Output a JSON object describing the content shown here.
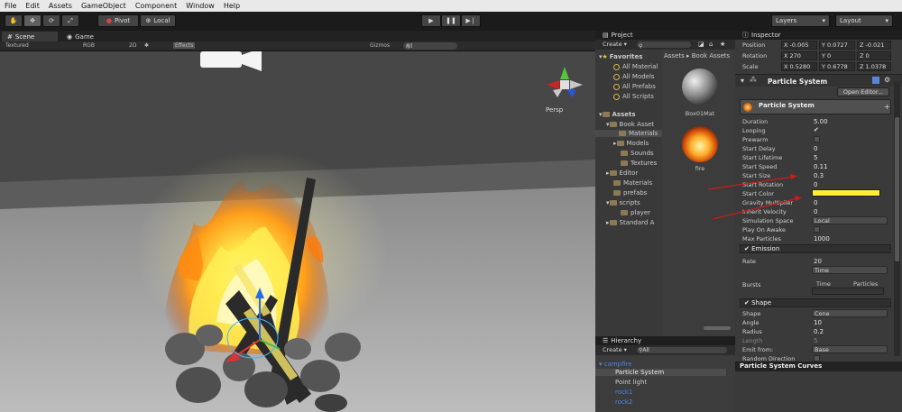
{
  "menu": [
    "File",
    "Edit",
    "Assets",
    "GameObject",
    "Component",
    "Window",
    "Help"
  ],
  "toolbar": {
    "pivot_label": "Pivot",
    "local_label": "Local",
    "layers_label": "Layers",
    "layout_label": "Layout"
  },
  "scene": {
    "tab_scene": "Scene",
    "tab_game": "Game",
    "render_mode": "Textured",
    "color_mode": "RGB",
    "mode_2d": "2D",
    "effects_label": "Effects",
    "gizmos_label": "Gizmos",
    "search_placeholder": "All",
    "persp_label": "Persp"
  },
  "project": {
    "title": "Project",
    "create_label": "Create",
    "breadcrumb": "Assets ▸ Book Assets",
    "favorites_label": "Favorites",
    "favorites": [
      "All Material",
      "All Models",
      "All Prefabs",
      "All Scripts"
    ],
    "assets_label": "Assets",
    "tree": [
      {
        "label": "Book Asset",
        "indent": 1
      },
      {
        "label": "Materials",
        "indent": 2,
        "selected": true
      },
      {
        "label": "Models",
        "indent": 2
      },
      {
        "label": "Sounds",
        "indent": 2
      },
      {
        "label": "Textures",
        "indent": 2
      },
      {
        "label": "Editor",
        "indent": 1
      },
      {
        "label": "Materials",
        "indent": 1
      },
      {
        "label": "prefabs",
        "indent": 1
      },
      {
        "label": "scripts",
        "indent": 1
      },
      {
        "label": "player",
        "indent": 2
      },
      {
        "label": "Standard A",
        "indent": 1
      }
    ],
    "items": [
      {
        "label": "Box01Mat",
        "kind": "sphere"
      },
      {
        "label": "fire",
        "kind": "fire"
      }
    ]
  },
  "hierarchy": {
    "title": "Hierarchy",
    "create_label": "Create",
    "search_placeholder": "All",
    "items": [
      {
        "label": "campfire",
        "color": "#4d86e6",
        "indent": 0
      },
      {
        "label": "Particle System",
        "color": "#e4e4e4",
        "indent": 1,
        "selected": true
      },
      {
        "label": "Point light",
        "color": "#d8d8d8",
        "indent": 1
      },
      {
        "label": "rock1",
        "color": "#4d86e6",
        "indent": 1
      },
      {
        "label": "rock2",
        "color": "#4d86e6",
        "indent": 1
      }
    ]
  },
  "inspector": {
    "title": "Inspector",
    "transform": {
      "position_label": "Position",
      "rotation_label": "Rotation",
      "scale_label": "Scale",
      "position": [
        "X -0.005",
        "Y 0.0727",
        "Z -0.021"
      ],
      "rotation": [
        "X 270",
        "Y 0",
        "Z 0"
      ],
      "scale": [
        "X 0.5280",
        "Y 0.6778",
        "Z 1.0378"
      ]
    },
    "component_title": "Particle System",
    "open_editor_label": "Open Editor...",
    "module_title": "Particle System",
    "props": [
      {
        "label": "Duration",
        "value": "5.00"
      },
      {
        "label": "Looping",
        "value": "✔"
      },
      {
        "label": "Prewarm",
        "value": ""
      },
      {
        "label": "Start Delay",
        "value": "0"
      },
      {
        "label": "Start Lifetime",
        "value": "5"
      },
      {
        "label": "Start Speed",
        "value": "0.11"
      },
      {
        "label": "Start Size",
        "value": "0.3"
      },
      {
        "label": "Start Rotation",
        "value": "0"
      },
      {
        "label": "Start Color",
        "value": ""
      },
      {
        "label": "Gravity Multiplier",
        "value": "0"
      },
      {
        "label": "Inherit Velocity",
        "value": "0"
      },
      {
        "label": "Simulation Space",
        "value": "Local"
      },
      {
        "label": "Play On Awake",
        "value": ""
      },
      {
        "label": "Max Particles",
        "value": "1000"
      }
    ],
    "emission": {
      "title": "Emission",
      "rate_label": "Rate",
      "rate_value": "20",
      "time_label": "Time",
      "bursts_label": "Bursts",
      "col_time": "Time",
      "col_particles": "Particles"
    },
    "shape": {
      "title": "Shape",
      "props": [
        {
          "label": "Shape",
          "value": "Cone"
        },
        {
          "label": "Angle",
          "value": "10"
        },
        {
          "label": "Radius",
          "value": "0.2"
        },
        {
          "label": "Length",
          "value": "5"
        },
        {
          "label": "Emit from:",
          "value": "Base"
        },
        {
          "label": "Random Direction",
          "value": ""
        }
      ]
    },
    "curves_label": "Particle System Curves",
    "start_color": "#ffee33"
  },
  "colors": {
    "menubar": "#e9e9e9",
    "toolbar": "#1b1b1b",
    "panel": "#3c3c3c",
    "selection": "#3e5f96",
    "accent_blue": "#4d86e6",
    "arrow_red": "#d11a1a"
  }
}
